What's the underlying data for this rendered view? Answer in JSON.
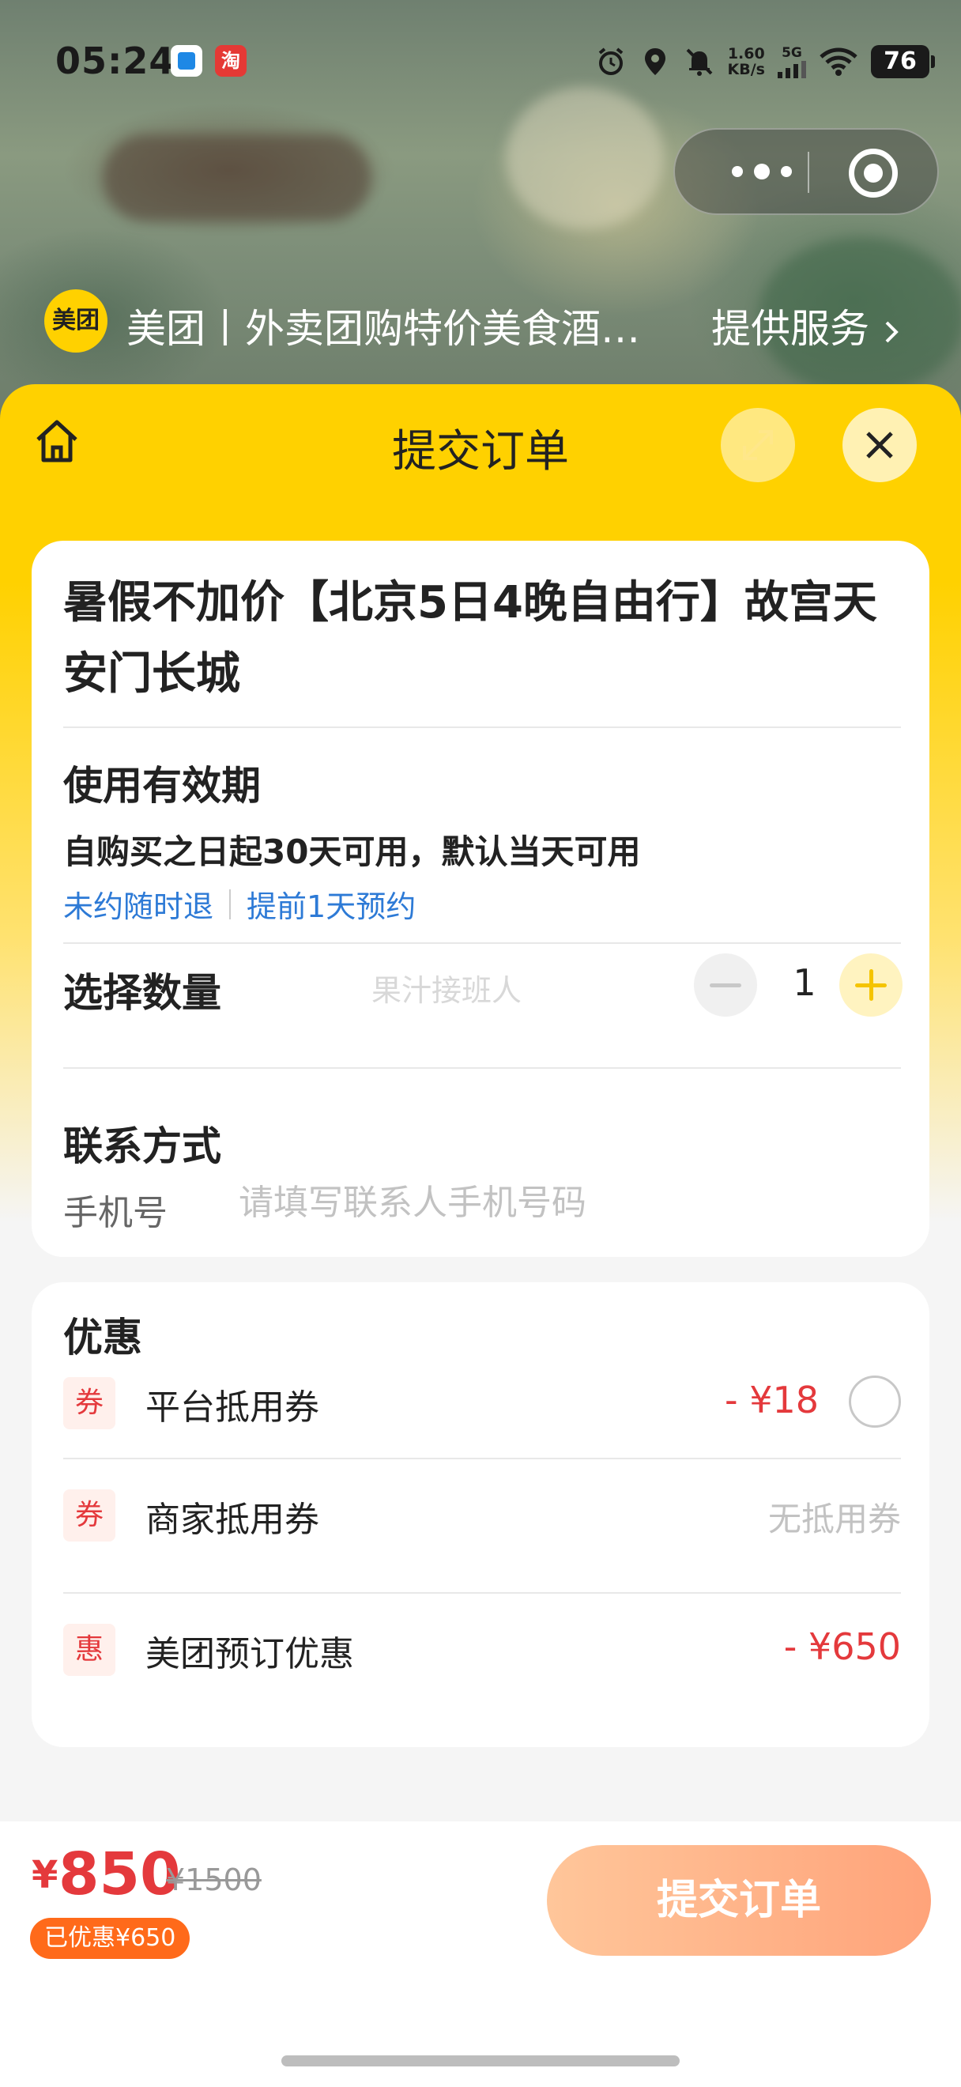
{
  "status_bar": {
    "time": "05:24",
    "net_speed": "1.60",
    "net_unit": "KB/s",
    "signal": "5G",
    "battery": "76",
    "app_icon_2": "淘"
  },
  "mini_program": {
    "logo_text": "美团",
    "title": "美团丨外卖团购特价美食酒…",
    "service_label": "提供服务"
  },
  "sheet": {
    "title": "提交订单"
  },
  "product": {
    "title": "暑假不加价【北京5日4晚自由行】故宫天安门长城",
    "validity_heading": "使用有效期",
    "validity_text": "自购买之日起30天可用，默认当天可用",
    "tags": [
      "未约随时退",
      "提前1天预约"
    ]
  },
  "quantity": {
    "label": "选择数量",
    "watermark": "果汁接班人",
    "value": "1"
  },
  "contact": {
    "heading": "联系方式",
    "phone_label": "手机号",
    "phone_placeholder": "请填写联系人手机号码",
    "phone_value": ""
  },
  "discounts": {
    "heading": "优惠",
    "items": [
      {
        "badge": "券",
        "name": "平台抵用券",
        "amount": "- ¥18"
      },
      {
        "badge": "券",
        "name": "商家抵用券",
        "amount": "无抵用券"
      },
      {
        "badge": "惠",
        "name": "美团预订优惠",
        "amount": "- ¥650"
      }
    ]
  },
  "bottom": {
    "currency": "¥",
    "price": "850",
    "original_price": "¥1500",
    "saved": "已优惠¥650",
    "submit_label": "提交订单"
  },
  "colors": {
    "brand_yellow": "#ffd100",
    "price_red": "#e4393c",
    "link_blue": "#2d7ad6",
    "submit_orange": "#ffa37a"
  }
}
